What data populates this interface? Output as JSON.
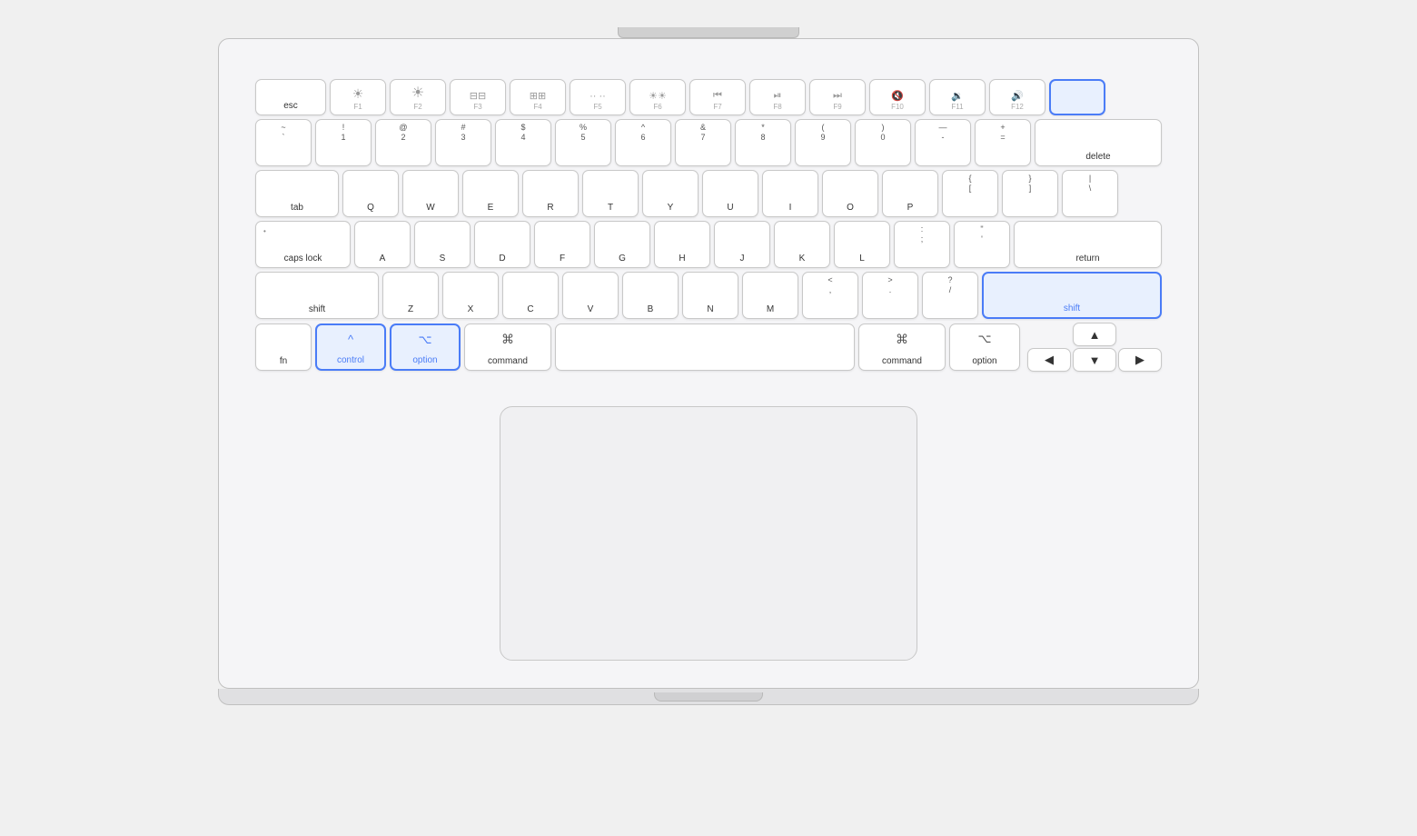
{
  "keyboard": {
    "rows": {
      "fn_row": {
        "esc": "esc",
        "f1": "F1",
        "f2": "F2",
        "f3": "F3",
        "f4": "F4",
        "f5": "F5",
        "f6": "F6",
        "f7": "F7",
        "f8": "F8",
        "f9": "F9",
        "f10": "F10",
        "f11": "F11",
        "f12": "F12",
        "power": ""
      },
      "num_row": {
        "tilde_top": "~",
        "tilde_bot": "`",
        "1_top": "!",
        "1_bot": "1",
        "2_top": "@",
        "2_bot": "2",
        "3_top": "#",
        "3_bot": "3",
        "4_top": "$",
        "4_bot": "4",
        "5_top": "%",
        "5_bot": "5",
        "6_top": "^",
        "6_bot": "6",
        "7_top": "&",
        "7_bot": "7",
        "8_top": "*",
        "8_bot": "8",
        "9_top": "(",
        "9_bot": "9",
        "0_top": ")",
        "0_bot": "0",
        "minus_top": "—",
        "minus_bot": "-",
        "plus_top": "+",
        "plus_bot": "=",
        "delete": "delete"
      },
      "qwerty": [
        "Q",
        "W",
        "E",
        "R",
        "T",
        "Y",
        "U",
        "I",
        "O",
        "P"
      ],
      "asdf": [
        "A",
        "S",
        "D",
        "F",
        "G",
        "H",
        "J",
        "K",
        "L"
      ],
      "zxcv": [
        "Z",
        "X",
        "C",
        "V",
        "B",
        "N",
        "M"
      ],
      "bottom": {
        "fn": "fn",
        "control": "control",
        "control_symbol": "^",
        "option_l": "option",
        "option_l_symbol": "⌥",
        "command_l": "command",
        "command_l_symbol": "⌘",
        "command_r": "command",
        "command_r_symbol": "⌘",
        "option_r": "option",
        "option_r_symbol": "⌥"
      }
    },
    "special_keys": {
      "tab": "tab",
      "caps_lock": "caps lock",
      "caps_dot": "•",
      "shift_l": "shift",
      "shift_r": "shift",
      "return": "return",
      "delete": "delete"
    },
    "bracket_row": {
      "open_top": "{",
      "open_bot": "[",
      "close_top": "}",
      "close_bot": "]",
      "pipe_top": "|",
      "pipe_bot": "\\"
    },
    "punct_row": {
      "colon_top": ":",
      "colon_bot": ";",
      "quote_top": "\"",
      "quote_bot": "'"
    },
    "shift_row": {
      "lt_top": "<",
      "lt_bot": ",",
      "gt_top": ">",
      "gt_bot": ".",
      "question_top": "?",
      "question_bot": "/"
    }
  },
  "highlighted_keys": {
    "control": true,
    "option_left": true,
    "shift_right": true,
    "power": true
  },
  "colors": {
    "highlight_bg": "#e8f0fe",
    "highlight_border": "#4a7cf7",
    "highlight_text": "#4a7cf7",
    "key_bg": "#ffffff",
    "key_border": "#c8c8c8",
    "body_bg": "#f5f5f7",
    "outer_border": "#c0c0c0"
  }
}
